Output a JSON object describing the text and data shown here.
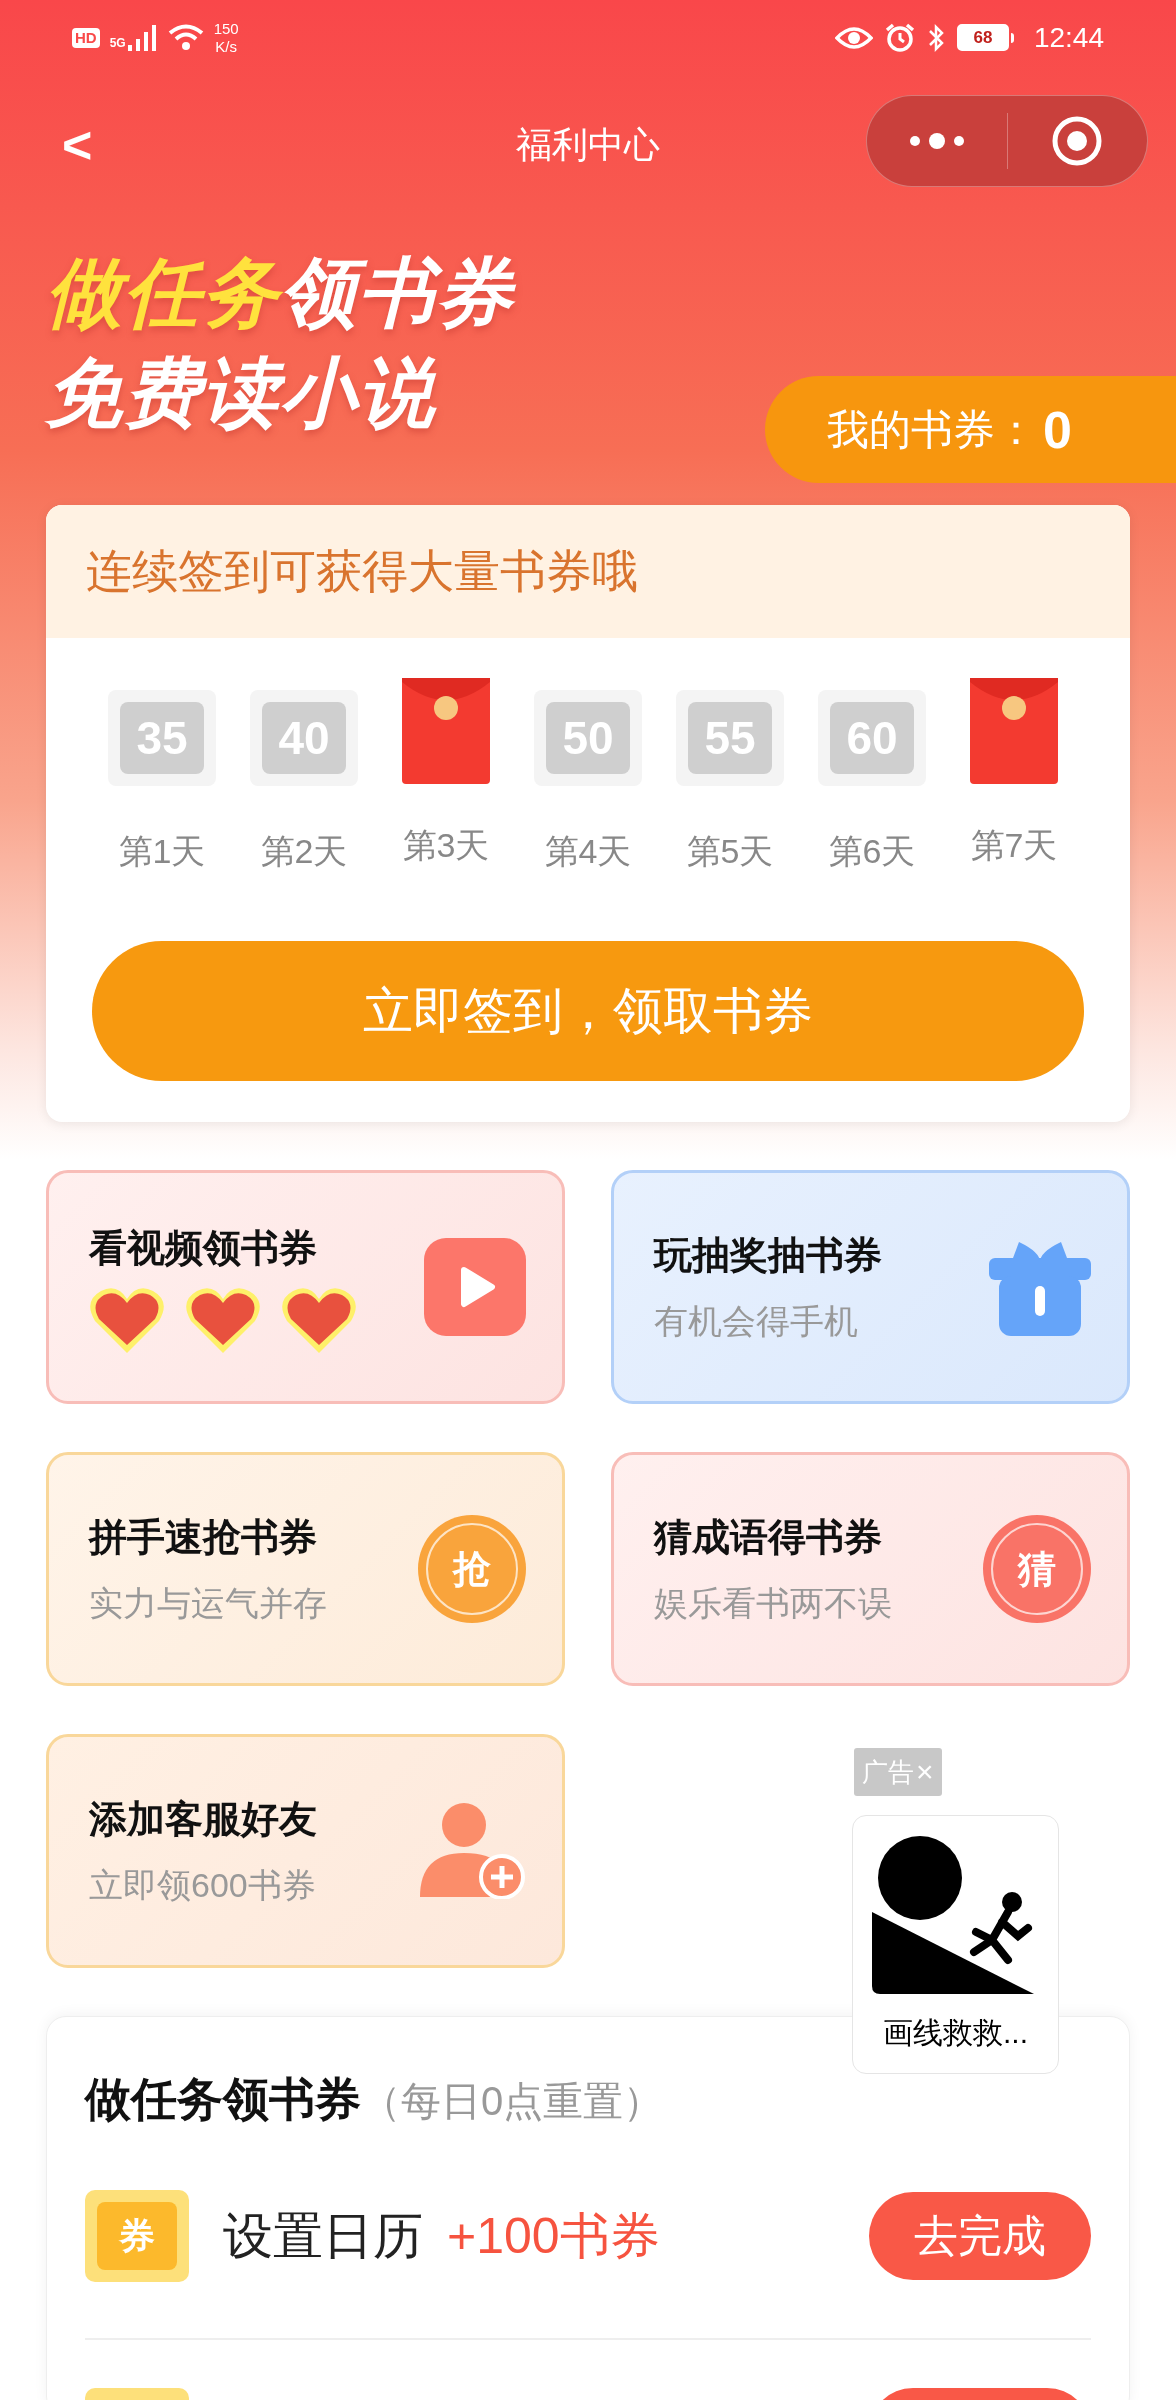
{
  "status_bar": {
    "hd": "HD",
    "network": "5G",
    "speed": "150",
    "speed_unit": "K/s",
    "battery": "68",
    "time": "12:44"
  },
  "nav": {
    "back": "<",
    "title": "福利中心"
  },
  "banner": {
    "highlight": "做任务",
    "line1_rest": "领书券",
    "line2": "免费读小说",
    "balance_label": "我的书券：",
    "balance": "0"
  },
  "signin": {
    "title": "连续签到可获得大量书券哦",
    "days": [
      {
        "kind": "points",
        "value": "35",
        "label": "第1天"
      },
      {
        "kind": "points",
        "value": "40",
        "label": "第2天"
      },
      {
        "kind": "red_packet",
        "label": "第3天"
      },
      {
        "kind": "points",
        "value": "50",
        "label": "第4天"
      },
      {
        "kind": "points",
        "value": "55",
        "label": "第5天"
      },
      {
        "kind": "points",
        "value": "60",
        "label": "第6天"
      },
      {
        "kind": "red_packet",
        "label": "第7天"
      }
    ],
    "button": "立即签到，领取书券"
  },
  "tasks": [
    {
      "kind": "video",
      "title": "看视频领书券",
      "stars": 3
    },
    {
      "kind": "lottery",
      "title": "玩抽奖抽书券",
      "subtitle": "有机会得手机"
    },
    {
      "kind": "grab",
      "title": "拼手速抢书券",
      "subtitle": "实力与运气并存",
      "icon_text": "抢"
    },
    {
      "kind": "guess",
      "title": "猜成语得书券",
      "subtitle": "娱乐看书两不误",
      "icon_text": "猜"
    },
    {
      "kind": "friend",
      "title": "添加客服好友",
      "subtitle": "立即领600书券"
    }
  ],
  "ad": {
    "label": "广告",
    "close": "×",
    "caption": "画线救救..."
  },
  "daily": {
    "title": "做任务领书券",
    "note": "（每日0点重置）",
    "items": [
      {
        "icon_text": "券",
        "name": "设置日历",
        "reward": "+100书券",
        "button": "去完成"
      }
    ]
  }
}
